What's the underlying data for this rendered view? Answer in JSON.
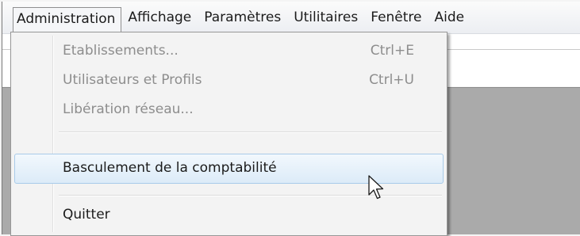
{
  "menubar": {
    "items": [
      {
        "label": "Administration"
      },
      {
        "label": "Affichage"
      },
      {
        "label": "Paramètres"
      },
      {
        "label": "Utilitaires"
      },
      {
        "label": "Fenêtre"
      },
      {
        "label": "Aide"
      }
    ]
  },
  "dropdown": {
    "items": [
      {
        "label": "Etablissements...",
        "shortcut": "Ctrl+E",
        "enabled": false
      },
      {
        "label": "Utilisateurs et Profils",
        "shortcut": "Ctrl+U",
        "enabled": false
      },
      {
        "label": "Libération réseau...",
        "shortcut": "",
        "enabled": false
      },
      {
        "label": "Basculement de la comptabilité",
        "shortcut": "",
        "enabled": true,
        "highlighted": true
      },
      {
        "label": "Quitter",
        "shortcut": "",
        "enabled": true
      }
    ]
  },
  "cursor": {
    "icon": "arrow-pointer-icon"
  },
  "colors": {
    "highlight_border": "#a8cbe9",
    "highlight_fill": "#dcebf8",
    "disabled_text": "#8d8d8d",
    "workspace": "#aaaaaa"
  }
}
